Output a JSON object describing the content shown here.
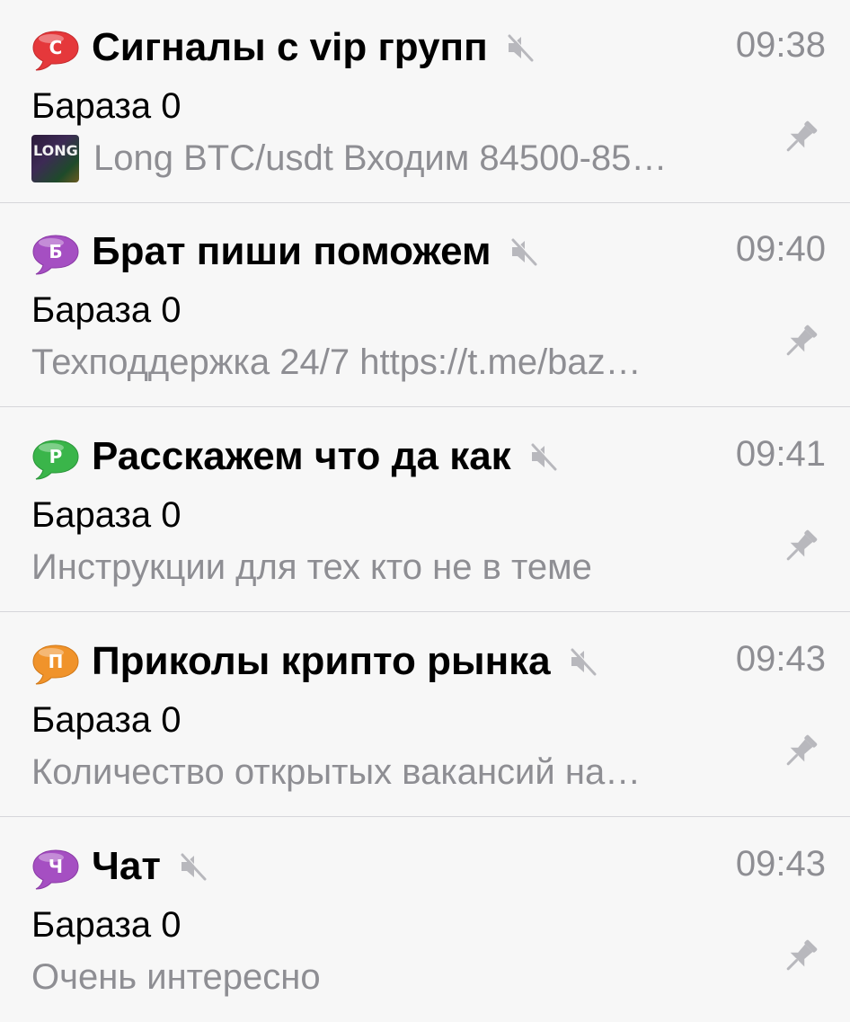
{
  "chats": [
    {
      "title": "Сигналы с vip групп",
      "letter": "С",
      "avatar_color": "#e5383b",
      "time": "09:38",
      "author": "Бараза 0",
      "preview": "Long BTC/usdt Входим 84500-85…",
      "thumbnail_text": "LONG",
      "muted": true,
      "pinned": true
    },
    {
      "title": "Брат пиши поможем",
      "letter": "Б",
      "avatar_color": "#a54fc2",
      "time": "09:40",
      "author": "Бараза 0",
      "preview": "Техподдержка 24/7 https://t.me/baz…",
      "muted": true,
      "pinned": true
    },
    {
      "title": "Расскажем что да как",
      "letter": "Р",
      "avatar_color": "#3ab54a",
      "time": "09:41",
      "author": "Бараза 0",
      "preview": "Инструкции для тех кто не в теме",
      "muted": true,
      "pinned": true
    },
    {
      "title": "Приколы крипто рынка",
      "letter": "П",
      "avatar_color": "#f0932b",
      "time": "09:43",
      "author": "Бараза 0",
      "preview": "Количество открытых вакансий на…",
      "muted": true,
      "pinned": true
    },
    {
      "title": "Чат",
      "letter": "Ч",
      "avatar_color": "#a54fc2",
      "time": "09:43",
      "author": "Бараза 0",
      "preview": "Очень интересно",
      "muted": true,
      "pinned": true
    }
  ],
  "icons": {
    "mute": "speaker-muted-icon",
    "pin": "pin-icon",
    "avatar": "speech-bubble-icon"
  },
  "colors": {
    "background": "#f7f7f7",
    "secondary_text": "#8e8e93",
    "separator": "#d6d6da",
    "icon_gray": "#b8b8bd"
  }
}
